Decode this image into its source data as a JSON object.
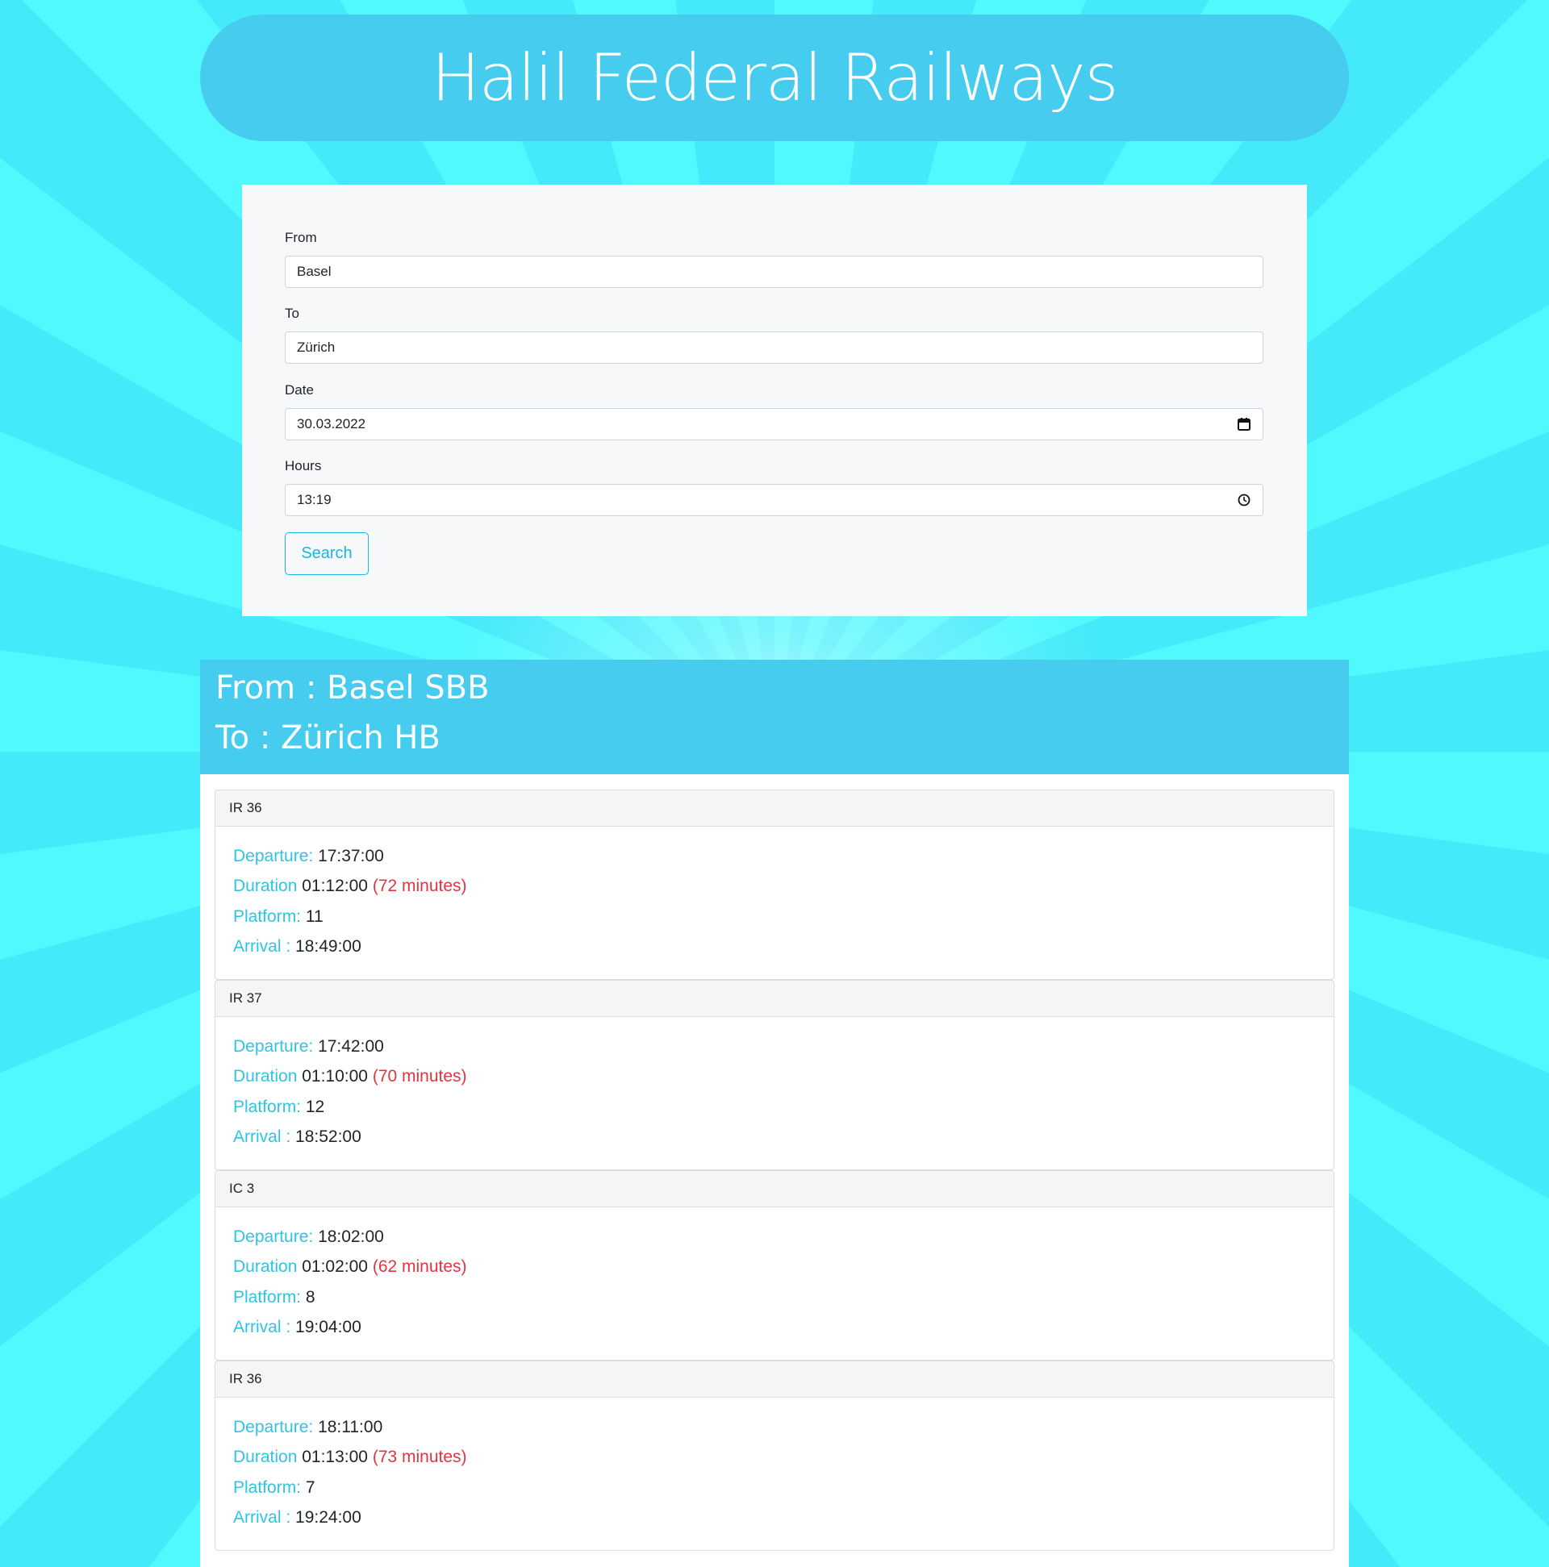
{
  "app": {
    "title": "Halil Federal Railways"
  },
  "search_form": {
    "from": {
      "label": "From",
      "value": "Basel"
    },
    "to": {
      "label": "To",
      "value": "Zürich"
    },
    "date": {
      "label": "Date",
      "value": "30.03.2022",
      "icon": "calendar-icon"
    },
    "hours": {
      "label": "Hours",
      "value": "13:19",
      "icon": "clock-icon"
    },
    "search_label": "Search"
  },
  "results": {
    "from_line": "From : Basel SBB",
    "to_line": "To : Zürich HB",
    "labels": {
      "departure": "Departure:",
      "duration": "Duration",
      "platform": "Platform:",
      "arrival": "Arrival :"
    },
    "connections": [
      {
        "train": "IR 36",
        "departure": "17:37:00",
        "duration": "01:12:00",
        "minutes": "(72 minutes)",
        "platform": "11",
        "arrival": "18:49:00"
      },
      {
        "train": "IR 37",
        "departure": "17:42:00",
        "duration": "01:10:00",
        "minutes": "(70 minutes)",
        "platform": "12",
        "arrival": "18:52:00"
      },
      {
        "train": "IC 3",
        "departure": "18:02:00",
        "duration": "01:02:00",
        "minutes": "(62 minutes)",
        "platform": "8",
        "arrival": "19:04:00"
      },
      {
        "train": "IR 36",
        "departure": "18:11:00",
        "duration": "01:13:00",
        "minutes": "(73 minutes)",
        "platform": "7",
        "arrival": "19:24:00"
      }
    ]
  },
  "colors": {
    "background": "#4ff9fe",
    "header": "#45ccee",
    "accent": "#2ec4e6",
    "minutes": "#e2343f"
  }
}
